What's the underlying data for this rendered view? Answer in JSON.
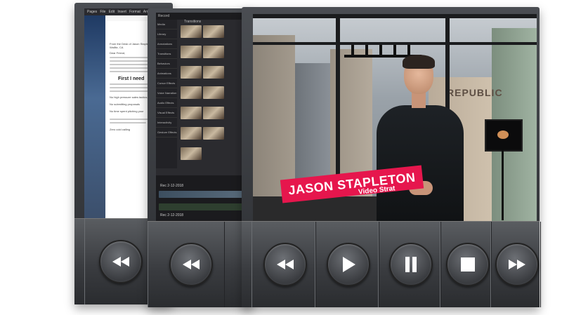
{
  "doc_window": {
    "menu": [
      "Pages",
      "File",
      "Edit",
      "Insert",
      "Format",
      "Arrange"
    ],
    "lines": [
      "From the Desk of Jason Stapleton",
      "Wallitz, CA",
      "Dear Friend,"
    ],
    "heading": "First I need",
    "bullets": [
      "No high pressure sales tactics.",
      "No submitting proposals",
      "No time spent pitching your"
    ],
    "footer_line": "Zero cold calling"
  },
  "editor_window": {
    "app_label": "Record",
    "panel_title": "Transitions",
    "menu": [
      "Media",
      "Library",
      "Annotations",
      "Transitions",
      "Behaviors",
      "Animations",
      "Cursor Effects",
      "Voice Narration",
      "Audio Effects",
      "Visual Effects",
      "Interactivity",
      "Gesture Effects"
    ],
    "date_label_1": "Rec 2-12-2018",
    "date_label_2": "Rec 2-12-2018"
  },
  "video": {
    "name": "JASON STAPLETON",
    "subtitle": "Video Strat",
    "sign": "REPUBLIC"
  },
  "controls": {
    "rewind": "rewind-icon",
    "play": "play-icon",
    "pause": "pause-icon",
    "stop": "stop-icon",
    "forward": "fast-forward-icon"
  },
  "colors": {
    "lower_third": "#e6164d",
    "player_body": "#3a3c40"
  }
}
